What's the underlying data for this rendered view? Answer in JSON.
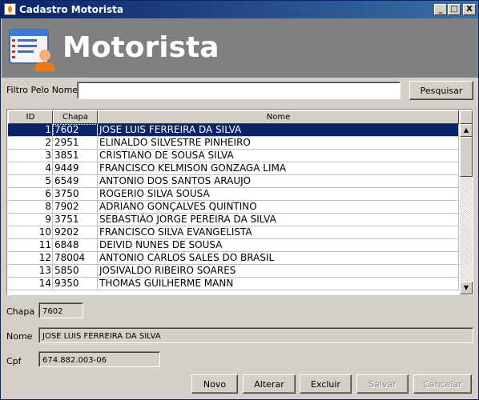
{
  "window": {
    "title": "Cadastro Motorista",
    "buttons": {
      "minimize": "_",
      "maximize": "□",
      "close": "X"
    }
  },
  "banner": {
    "title": "Motorista",
    "icon": "user-list-icon"
  },
  "filter": {
    "label": "Filtro Pelo Nome",
    "value": "",
    "search_button": "Pesquisar"
  },
  "table": {
    "columns": [
      "ID",
      "Chapa",
      "Nome"
    ],
    "selected_index": 0,
    "rows": [
      {
        "id": "1",
        "chapa": "7602",
        "nome": "JOSE LUIS FERREIRA DA SILVA"
      },
      {
        "id": "2",
        "chapa": "2951",
        "nome": "ELINALDO SILVESTRE PINHEIRO"
      },
      {
        "id": "3",
        "chapa": "3851",
        "nome": "CRISTIANO DE SOUSA SILVA"
      },
      {
        "id": "4",
        "chapa": "9449",
        "nome": "FRANCISCO KELMISON GONZAGA LIMA"
      },
      {
        "id": "5",
        "chapa": "6549",
        "nome": "ANTONIO DOS SANTOS ARAUJO"
      },
      {
        "id": "6",
        "chapa": "3750",
        "nome": "ROGERIO SILVA SOUSA"
      },
      {
        "id": "8",
        "chapa": "7902",
        "nome": "ADRIANO GONÇALVES QUINTINO"
      },
      {
        "id": "9",
        "chapa": "3751",
        "nome": "SEBASTIÃO JORGE PEREIRA DA SILVA"
      },
      {
        "id": "10",
        "chapa": "9202",
        "nome": "FRANCISCO SILVA EVANGELISTA"
      },
      {
        "id": "11",
        "chapa": "6848",
        "nome": "DEIVID NUNES DE SOUSA"
      },
      {
        "id": "12",
        "chapa": "78004",
        "nome": "ANTONIO CARLOS SALES DO BRASIL"
      },
      {
        "id": "13",
        "chapa": "5850",
        "nome": "JOSIVALDO RIBEIRO SOARES"
      },
      {
        "id": "14",
        "chapa": "9350",
        "nome": "THOMAS GUILHERME MANN"
      }
    ]
  },
  "form": {
    "chapa": {
      "label": "Chapa",
      "value": "7602"
    },
    "nome": {
      "label": "Nome",
      "value": "JOSE LUIS FERREIRA DA SILVA"
    },
    "cpf": {
      "label": "Cpf",
      "value": "674.882.003-06"
    }
  },
  "actions": {
    "novo": "Novo",
    "alterar": "Alterar",
    "excluir": "Excluir",
    "salvar": "Salvar",
    "cancelar": "Cancelar"
  },
  "colors": {
    "title_bar": "#0a246a",
    "banner": "#808080",
    "selection": "#0a246a"
  }
}
